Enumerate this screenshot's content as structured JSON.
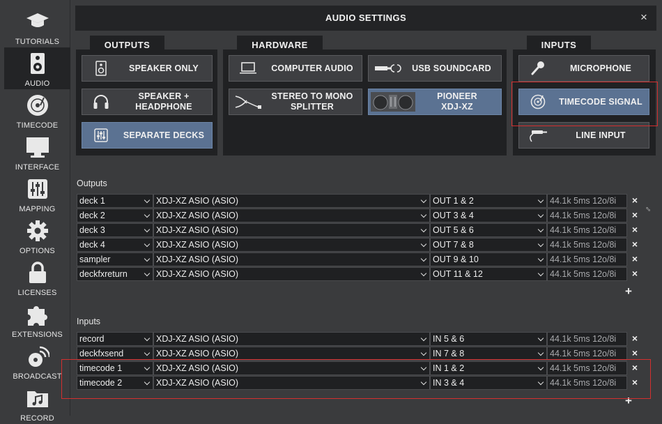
{
  "sidebar": {
    "items": [
      {
        "label": "TUTORIALS",
        "icon": "graduation-cap-icon"
      },
      {
        "label": "AUDIO",
        "icon": "speaker-icon"
      },
      {
        "label": "TIMECODE",
        "icon": "vinyl-icon"
      },
      {
        "label": "INTERFACE",
        "icon": "monitor-icon"
      },
      {
        "label": "MAPPING",
        "icon": "sliders-icon"
      },
      {
        "label": "OPTIONS",
        "icon": "gear-icon"
      },
      {
        "label": "LICENSES",
        "icon": "lock-icon"
      },
      {
        "label": "EXTENSIONS",
        "icon": "puzzle-icon"
      },
      {
        "label": "BROADCAST",
        "icon": "broadcast-icon"
      },
      {
        "label": "RECORD",
        "icon": "music-folder-icon"
      }
    ]
  },
  "dialog": {
    "title": "AUDIO SETTINGS",
    "close": "×"
  },
  "outputs_panel": {
    "title": "OUTPUTS",
    "buttons": [
      "SPEAKER ONLY",
      "SPEAKER +\nHEADPHONE",
      "SEPARATE DECKS"
    ]
  },
  "hardware_panel": {
    "title": "HARDWARE",
    "buttons": [
      "COMPUTER AUDIO",
      "USB SOUNDCARD",
      "STEREO TO MONO\nSPLITTER",
      "PIONEER\nXDJ-XZ"
    ]
  },
  "inputs_panel": {
    "title": "INPUTS",
    "buttons": [
      "MICROPHONE",
      "TIMECODE SIGNAL",
      "LINE INPUT"
    ]
  },
  "outputs": {
    "label": "Outputs",
    "rows": [
      {
        "name": "deck 1",
        "device": "XDJ-XZ ASIO (ASIO)",
        "channel": "OUT 1 & 2",
        "info": "44.1k 5ms 12o/8i"
      },
      {
        "name": "deck 2",
        "device": "XDJ-XZ ASIO (ASIO)",
        "channel": "OUT 3 & 4",
        "info": "44.1k 5ms 12o/8i"
      },
      {
        "name": "deck 3",
        "device": "XDJ-XZ ASIO (ASIO)",
        "channel": "OUT 5 & 6",
        "info": "44.1k 5ms 12o/8i"
      },
      {
        "name": "deck 4",
        "device": "XDJ-XZ ASIO (ASIO)",
        "channel": "OUT 7 & 8",
        "info": "44.1k 5ms 12o/8i"
      },
      {
        "name": "sampler",
        "device": "XDJ-XZ ASIO (ASIO)",
        "channel": "OUT 9 & 10",
        "info": "44.1k 5ms 12o/8i"
      },
      {
        "name": "deckfxreturn",
        "device": "XDJ-XZ ASIO (ASIO)",
        "channel": "OUT 11 & 12",
        "info": "44.1k 5ms 12o/8i"
      }
    ]
  },
  "inputs": {
    "label": "Inputs",
    "rows": [
      {
        "name": "record",
        "device": "XDJ-XZ ASIO (ASIO)",
        "channel": "IN 5 & 6",
        "info": "44.1k 5ms 12o/8i"
      },
      {
        "name": "deckfxsend",
        "device": "XDJ-XZ ASIO (ASIO)",
        "channel": "IN 7 & 8",
        "info": "44.1k 5ms 12o/8i"
      },
      {
        "name": "timecode 1",
        "device": "XDJ-XZ ASIO (ASIO)",
        "channel": "IN 1 & 2",
        "info": "44.1k 5ms 12o/8i"
      },
      {
        "name": "timecode 2",
        "device": "XDJ-XZ ASIO (ASIO)",
        "channel": "IN 3 & 4",
        "info": "44.1k 5ms 12o/8i"
      }
    ]
  },
  "delete_glyph": "×",
  "add_glyph": "+",
  "colors": {
    "selected_button": "#5b7292",
    "highlight_box": "#d32f2f"
  }
}
